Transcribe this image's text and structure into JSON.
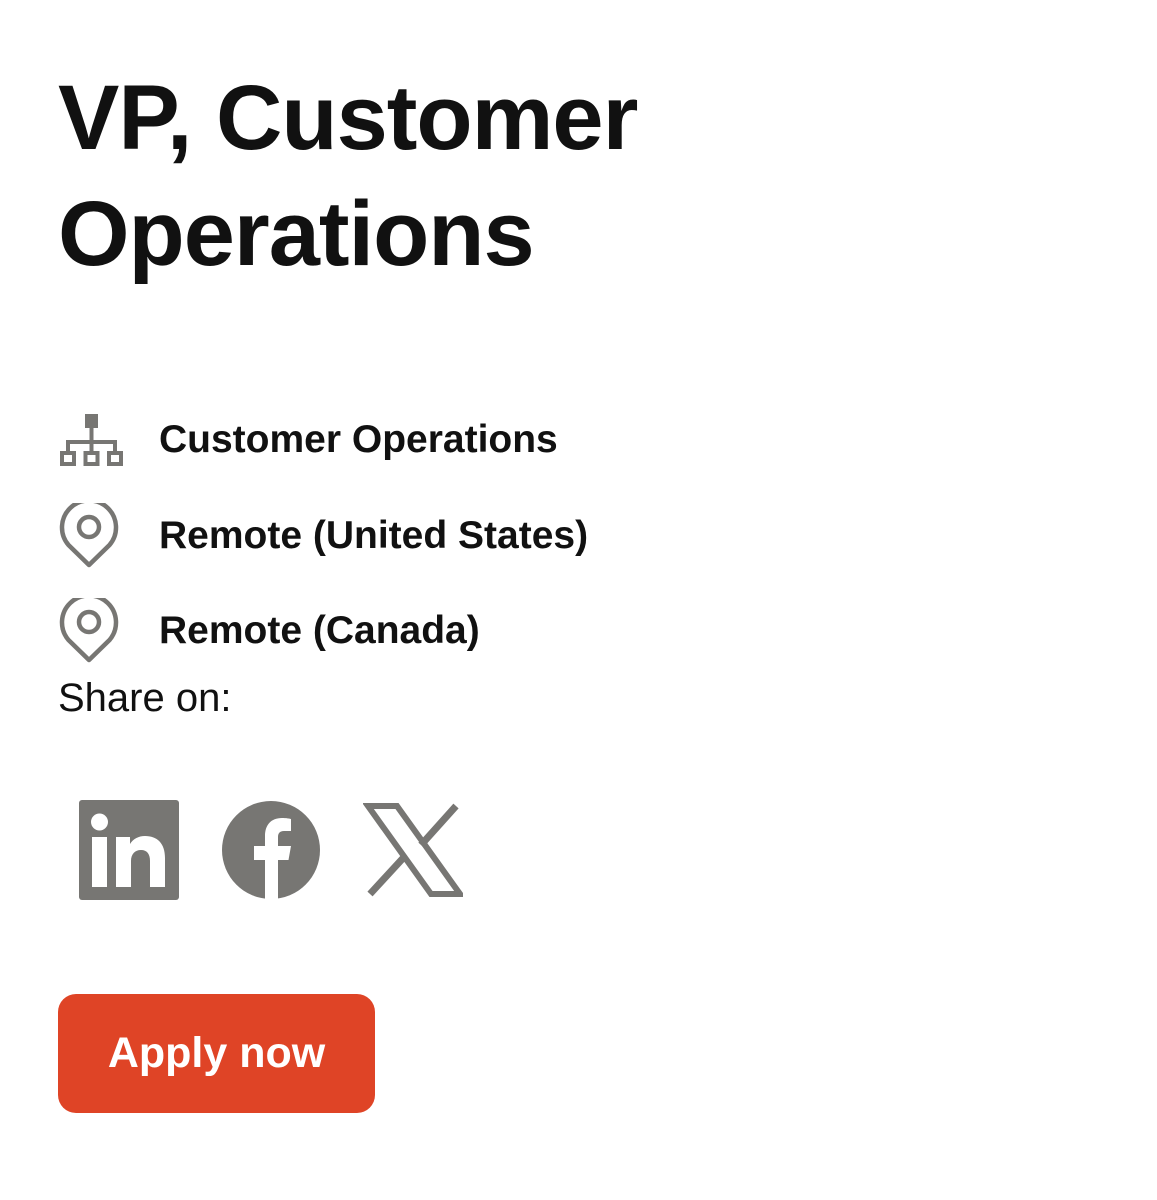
{
  "job": {
    "title": "VP, Customer Operations"
  },
  "meta": {
    "department": {
      "label": "Customer Operations",
      "icon": "org-chart-icon"
    },
    "locations": [
      {
        "label": "Remote (United States)",
        "icon": "map-pin-icon"
      },
      {
        "label": "Remote (Canada)",
        "icon": "map-pin-icon"
      }
    ]
  },
  "share": {
    "label": "Share on:",
    "networks": [
      {
        "name": "linkedin",
        "icon": "linkedin-icon"
      },
      {
        "name": "facebook",
        "icon": "facebook-icon"
      },
      {
        "name": "x",
        "icon": "x-icon"
      }
    ]
  },
  "apply": {
    "label": "Apply now"
  },
  "colors": {
    "text": "#111111",
    "icon_gray": "#777673",
    "accent": "#DF4426",
    "button_text": "#FFFFFF",
    "background": "#FFFFFF"
  }
}
